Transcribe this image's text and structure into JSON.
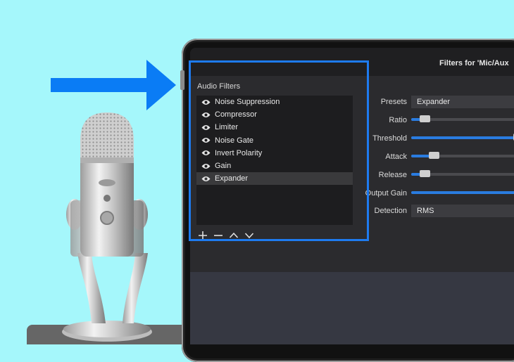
{
  "window": {
    "title": "Filters for 'Mic/Aux"
  },
  "audio_filters": {
    "heading": "Audio Filters",
    "items": [
      {
        "label": "Noise Suppression"
      },
      {
        "label": "Compressor"
      },
      {
        "label": "Limiter"
      },
      {
        "label": "Noise Gate"
      },
      {
        "label": "Invert Polarity"
      },
      {
        "label": "Gain"
      },
      {
        "label": "Expander"
      }
    ],
    "selected": "Expander",
    "toolbar_icons": [
      "plus-icon",
      "minus-icon",
      "chevron-up-icon",
      "chevron-down-icon"
    ]
  },
  "properties": {
    "presets": {
      "label": "Presets",
      "value": "Expander"
    },
    "ratio": {
      "label": "Ratio",
      "level": 0.12
    },
    "threshold": {
      "label": "Threshold",
      "level": 0.95
    },
    "attack": {
      "label": "Attack",
      "level": 0.2
    },
    "release": {
      "label": "Release",
      "level": 0.12
    },
    "output_gain": {
      "label": "Output Gain",
      "level": 1.0
    },
    "detection": {
      "label": "Detection",
      "value": "RMS"
    }
  },
  "colors": {
    "background": "#a5f7fb",
    "arrow": "#0a7cf5",
    "highlight": "#1e7bf0",
    "slider_fill": "#2a7ce0"
  }
}
